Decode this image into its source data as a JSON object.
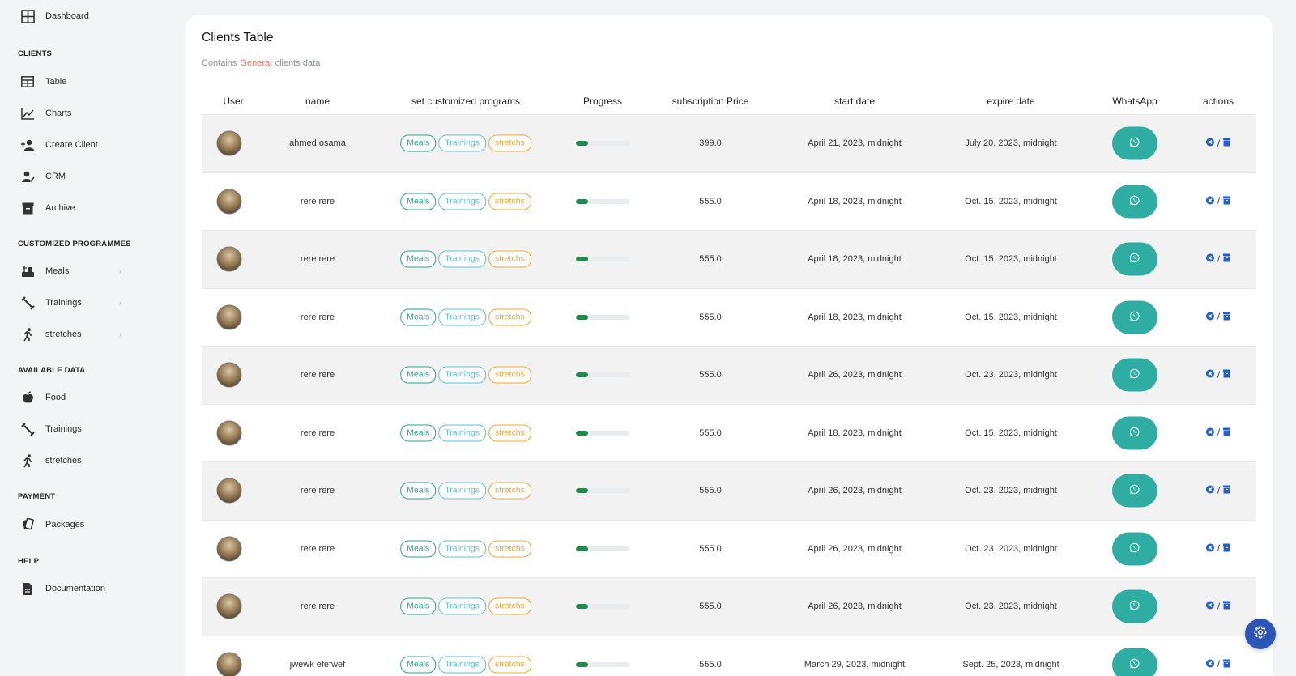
{
  "sidebar": {
    "dashboard": "Dashboard",
    "sections": {
      "clients": "CLIENTS",
      "programmes": "CUSTOMIZED PROGRAMMES",
      "available": "AVAILABLE DATA",
      "payment": "PAYMENT",
      "help": "HELP"
    },
    "items": {
      "table": "Table",
      "charts": "Charts",
      "create_client": "Creare Client",
      "crm": "CRM",
      "archive": "Archive",
      "meals": "Meals",
      "trainings": "Trainings",
      "stretches": "stretches",
      "food": "Food",
      "trainings2": "Trainings",
      "stretches2": "stretches",
      "packages": "Packages",
      "documentation": "Documentation"
    },
    "chevron": "›"
  },
  "card": {
    "title": "Clients Table",
    "subtitle_pre": "Contains",
    "subtitle_highlight": "General",
    "subtitle_post": "clients data"
  },
  "table": {
    "headers": [
      "User",
      "name",
      "set customized programs",
      "Progress",
      "subscription Price",
      "start date",
      "expire date",
      "WhatsApp",
      "actions"
    ],
    "tags": {
      "meals": "Meals",
      "trainings": "Trainings",
      "stretches": "stretchs"
    },
    "separator": "/",
    "rows": [
      {
        "name": "ahmed osama",
        "price": "399.0",
        "start": "April 21, 2023, midnight",
        "expire": "July 20, 2023, midnight",
        "progress": 0.22
      },
      {
        "name": "rere rere",
        "price": "555.0",
        "start": "April 18, 2023, midnight",
        "expire": "Oct. 15, 2023, midnight",
        "progress": 0.22
      },
      {
        "name": "rere rere",
        "price": "555.0",
        "start": "April 18, 2023, midnight",
        "expire": "Oct. 15, 2023, midnight",
        "progress": 0.22
      },
      {
        "name": "rere rere",
        "price": "555.0",
        "start": "April 18, 2023, midnight",
        "expire": "Oct. 15, 2023, midnight",
        "progress": 0.22
      },
      {
        "name": "rere rere",
        "price": "555.0",
        "start": "April 26, 2023, midnight",
        "expire": "Oct. 23, 2023, midnight",
        "progress": 0.22
      },
      {
        "name": "rere rere",
        "price": "555.0",
        "start": "April 18, 2023, midnight",
        "expire": "Oct. 15, 2023, midnight",
        "progress": 0.22
      },
      {
        "name": "rere rere",
        "price": "555.0",
        "start": "April 26, 2023, midnight",
        "expire": "Oct. 23, 2023, midnight",
        "progress": 0.22
      },
      {
        "name": "rere rere",
        "price": "555.0",
        "start": "April 26, 2023, midnight",
        "expire": "Oct. 23, 2023, midnight",
        "progress": 0.22
      },
      {
        "name": "rere rere",
        "price": "555.0",
        "start": "April 26, 2023, midnight",
        "expire": "Oct. 23, 2023, midnight",
        "progress": 0.22
      },
      {
        "name": "jwewk efefwef",
        "price": "555.0",
        "start": "March 29, 2023, midnight",
        "expire": "Sept. 25, 2023, midnight",
        "progress": 0.22
      }
    ]
  },
  "colors": {
    "whatsapp": "#2fada3",
    "progress_fill": "#1f8a4c",
    "highlight": "#e8735c",
    "action_blue": "#1f5fd1",
    "fab": "#2c55b8"
  }
}
